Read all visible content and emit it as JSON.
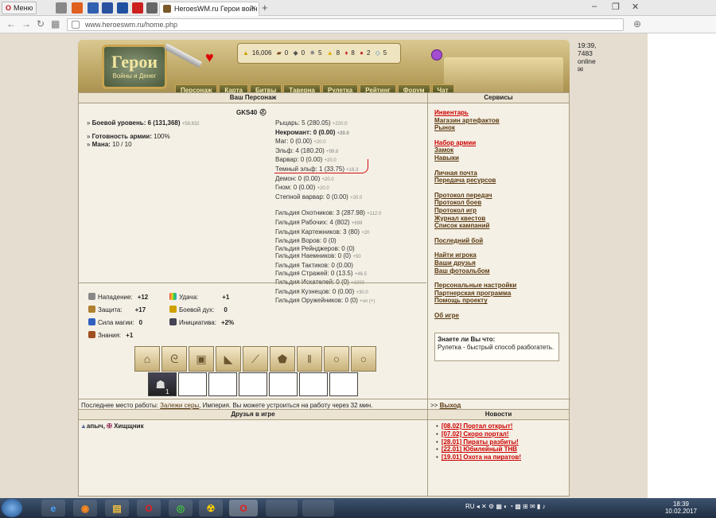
{
  "browser": {
    "menu_label": "Меню",
    "tab_title": "HeroesWM.ru Герои войн",
    "url": "www.heroeswm.ru/home.php",
    "win_controls": [
      "–",
      "❐",
      "✕"
    ]
  },
  "header": {
    "logo_text": "Герои",
    "logo_sub": "Войны и Денег",
    "clock": "19:39, 7483 online",
    "resources": [
      {
        "icon": "gold-icon",
        "value": "16,006"
      },
      {
        "icon": "wood-icon",
        "value": "0"
      },
      {
        "icon": "ore-icon",
        "value": "0"
      },
      {
        "icon": "mercury-icon",
        "value": "5"
      },
      {
        "icon": "sulfur-icon",
        "value": "8"
      },
      {
        "icon": "crystal-icon",
        "value": "8"
      },
      {
        "icon": "gems-icon",
        "value": "2"
      },
      {
        "icon": "diamond-icon",
        "value": "5"
      }
    ],
    "nav": [
      "Персонаж",
      "Карта",
      "Битвы",
      "Таверна",
      "Рулетка",
      "Рейтинг",
      "Форум",
      "Чат"
    ]
  },
  "character": {
    "panel_title": "Ваш Персонаж",
    "name": "GKS40",
    "combat_label": "Боевой уровень:",
    "combat_value": "6 (131,368)",
    "combat_next": "+58,632",
    "army_ready_label": "Готовность армии:",
    "army_ready_value": "100%",
    "mana_label": "Мана:",
    "mana_value": "10 / 10",
    "factions": [
      {
        "text": "Рыцарь: 5 (280.05)",
        "next": "+220.0",
        "strong": false
      },
      {
        "text": "Некромант: 0 (0.00)",
        "next": "+20.0",
        "strong": true
      },
      {
        "text": "Маг: 0 (0.00)",
        "next": "+20.0",
        "strong": false
      },
      {
        "text": "Эльф: 4 (180.20)",
        "next": "+99.8",
        "strong": false
      },
      {
        "text": "Варвар: 0 (0.00)",
        "next": "+20.0",
        "strong": false
      },
      {
        "text": "Темный эльф: 1 (33.75)",
        "next": "+16.3",
        "strong": false
      },
      {
        "text": "Демон: 0 (0.00)",
        "next": "+20.0",
        "strong": false
      },
      {
        "text": "Гном: 0 (0.00)",
        "next": "+20.0",
        "strong": false
      },
      {
        "text": "Степной варвар: 0 (0.00)",
        "next": "+20.0",
        "strong": false
      }
    ],
    "guilds": [
      {
        "text": "Гильдия Охотников: 3 (287.98)",
        "next": "+112.0"
      },
      {
        "text": "Гильдия Рабочих: 4 (802)",
        "next": "+698"
      },
      {
        "text": "Гильдия Картежников: 3 (80)",
        "next": "+20"
      },
      {
        "text": "Гильдия Воров: 0 (0)",
        "next": ""
      },
      {
        "text": "Гильдия Рейнджеров: 0 (0)",
        "next": ""
      },
      {
        "text": "Гильдия Наемников: 0 (0)",
        "next": "+50"
      },
      {
        "text": "Гильдия Тактиков: 0 (0.00)",
        "next": ""
      },
      {
        "text": "Гильдия Стражей: 0 (13.5)",
        "next": "+46.5"
      },
      {
        "text": "Гильдия Искателей: 0 (0)",
        "next": "+1000"
      },
      {
        "text": "Гильдия Кузнецов: 0 (0.00)",
        "next": "+30.0"
      },
      {
        "text": "Гильдия Оружейников: 0 (0)",
        "next": "+on (+)"
      }
    ],
    "attributes": [
      {
        "label": "Нападение:",
        "value": "+12",
        "icon": "attack-icon"
      },
      {
        "label": "Защита:",
        "value": "+17",
        "icon": "defense-icon"
      },
      {
        "label": "Сила магии:",
        "value": "0",
        "icon": "spellpower-icon"
      },
      {
        "label": "Знания:",
        "value": "+1",
        "icon": "knowledge-icon"
      },
      {
        "label": "Удача:",
        "value": "+1",
        "icon": "luck-icon"
      },
      {
        "label": "Боевой дух:",
        "value": "0",
        "icon": "morale-icon"
      },
      {
        "label": "Инициатива:",
        "value": "+2%",
        "icon": "initiative-icon"
      }
    ],
    "equipment": [
      "hood-icon",
      "amulet-icon",
      "armor-icon",
      "cloak-icon",
      "sword-icon",
      "shield-icon",
      "boots-icon",
      "ring-icon",
      "ring-icon"
    ],
    "army_count": "1",
    "work_text": "Последнее место работы:",
    "work_link": "Залежи серы",
    "work_rest": ", Империя. Вы можете устроиться на работу через 32 мин."
  },
  "services": {
    "panel_title": "Сервисы",
    "groups": [
      [
        {
          "label": "Инвентарь",
          "red": true
        },
        {
          "label": "Магазин артефактов"
        },
        {
          "label": "Рынок"
        }
      ],
      [
        {
          "label": "Набор армии",
          "red": true
        },
        {
          "label": "Замок"
        },
        {
          "label": "Навыки"
        }
      ],
      [
        {
          "label": "Личная почта"
        },
        {
          "label": "Передача ресурсов"
        }
      ],
      [
        {
          "label": "Протокол передач"
        },
        {
          "label": "Протокол боев"
        },
        {
          "label": "Протокол игр"
        },
        {
          "label": "Журнал квестов"
        },
        {
          "label": "Список кампаний"
        }
      ],
      [
        {
          "label": "Последний бой"
        }
      ],
      [
        {
          "label": "Найти игрока"
        },
        {
          "label": "Ваши друзья"
        },
        {
          "label": "Ваш фотоальбом"
        }
      ],
      [
        {
          "label": "Персональные настройки"
        },
        {
          "label": "Партнерская программа"
        },
        {
          "label": "Помощь проекту"
        }
      ],
      [
        {
          "label": "Об игре"
        }
      ]
    ],
    "tip_title": "Знаете ли Вы что:",
    "tip_text": "Рулетка - быстрый способ разбогатеть.",
    "exit_prefix": ">>",
    "exit_label": "Выход"
  },
  "friends": {
    "panel_title": "Друзья в игре",
    "list": [
      "апыч",
      "Хищщник"
    ]
  },
  "news": {
    "panel_title": "Новости",
    "items": [
      "[08.02] Портал открыт!",
      "[07.02] Скоро портал!",
      "[28.01] Пираты разбиты!",
      "[22.01] Юбилейный ТНВ",
      "[19.01] Охота на пиратов!"
    ]
  },
  "taskbar": {
    "lang": "RU",
    "time": "18:39",
    "date": "10.02.2017"
  },
  "colors": {
    "accent": "#c00000",
    "link": "#5a3a10",
    "panel_bg": "#f5f0e6",
    "page_bg": "#e4ddd0"
  }
}
